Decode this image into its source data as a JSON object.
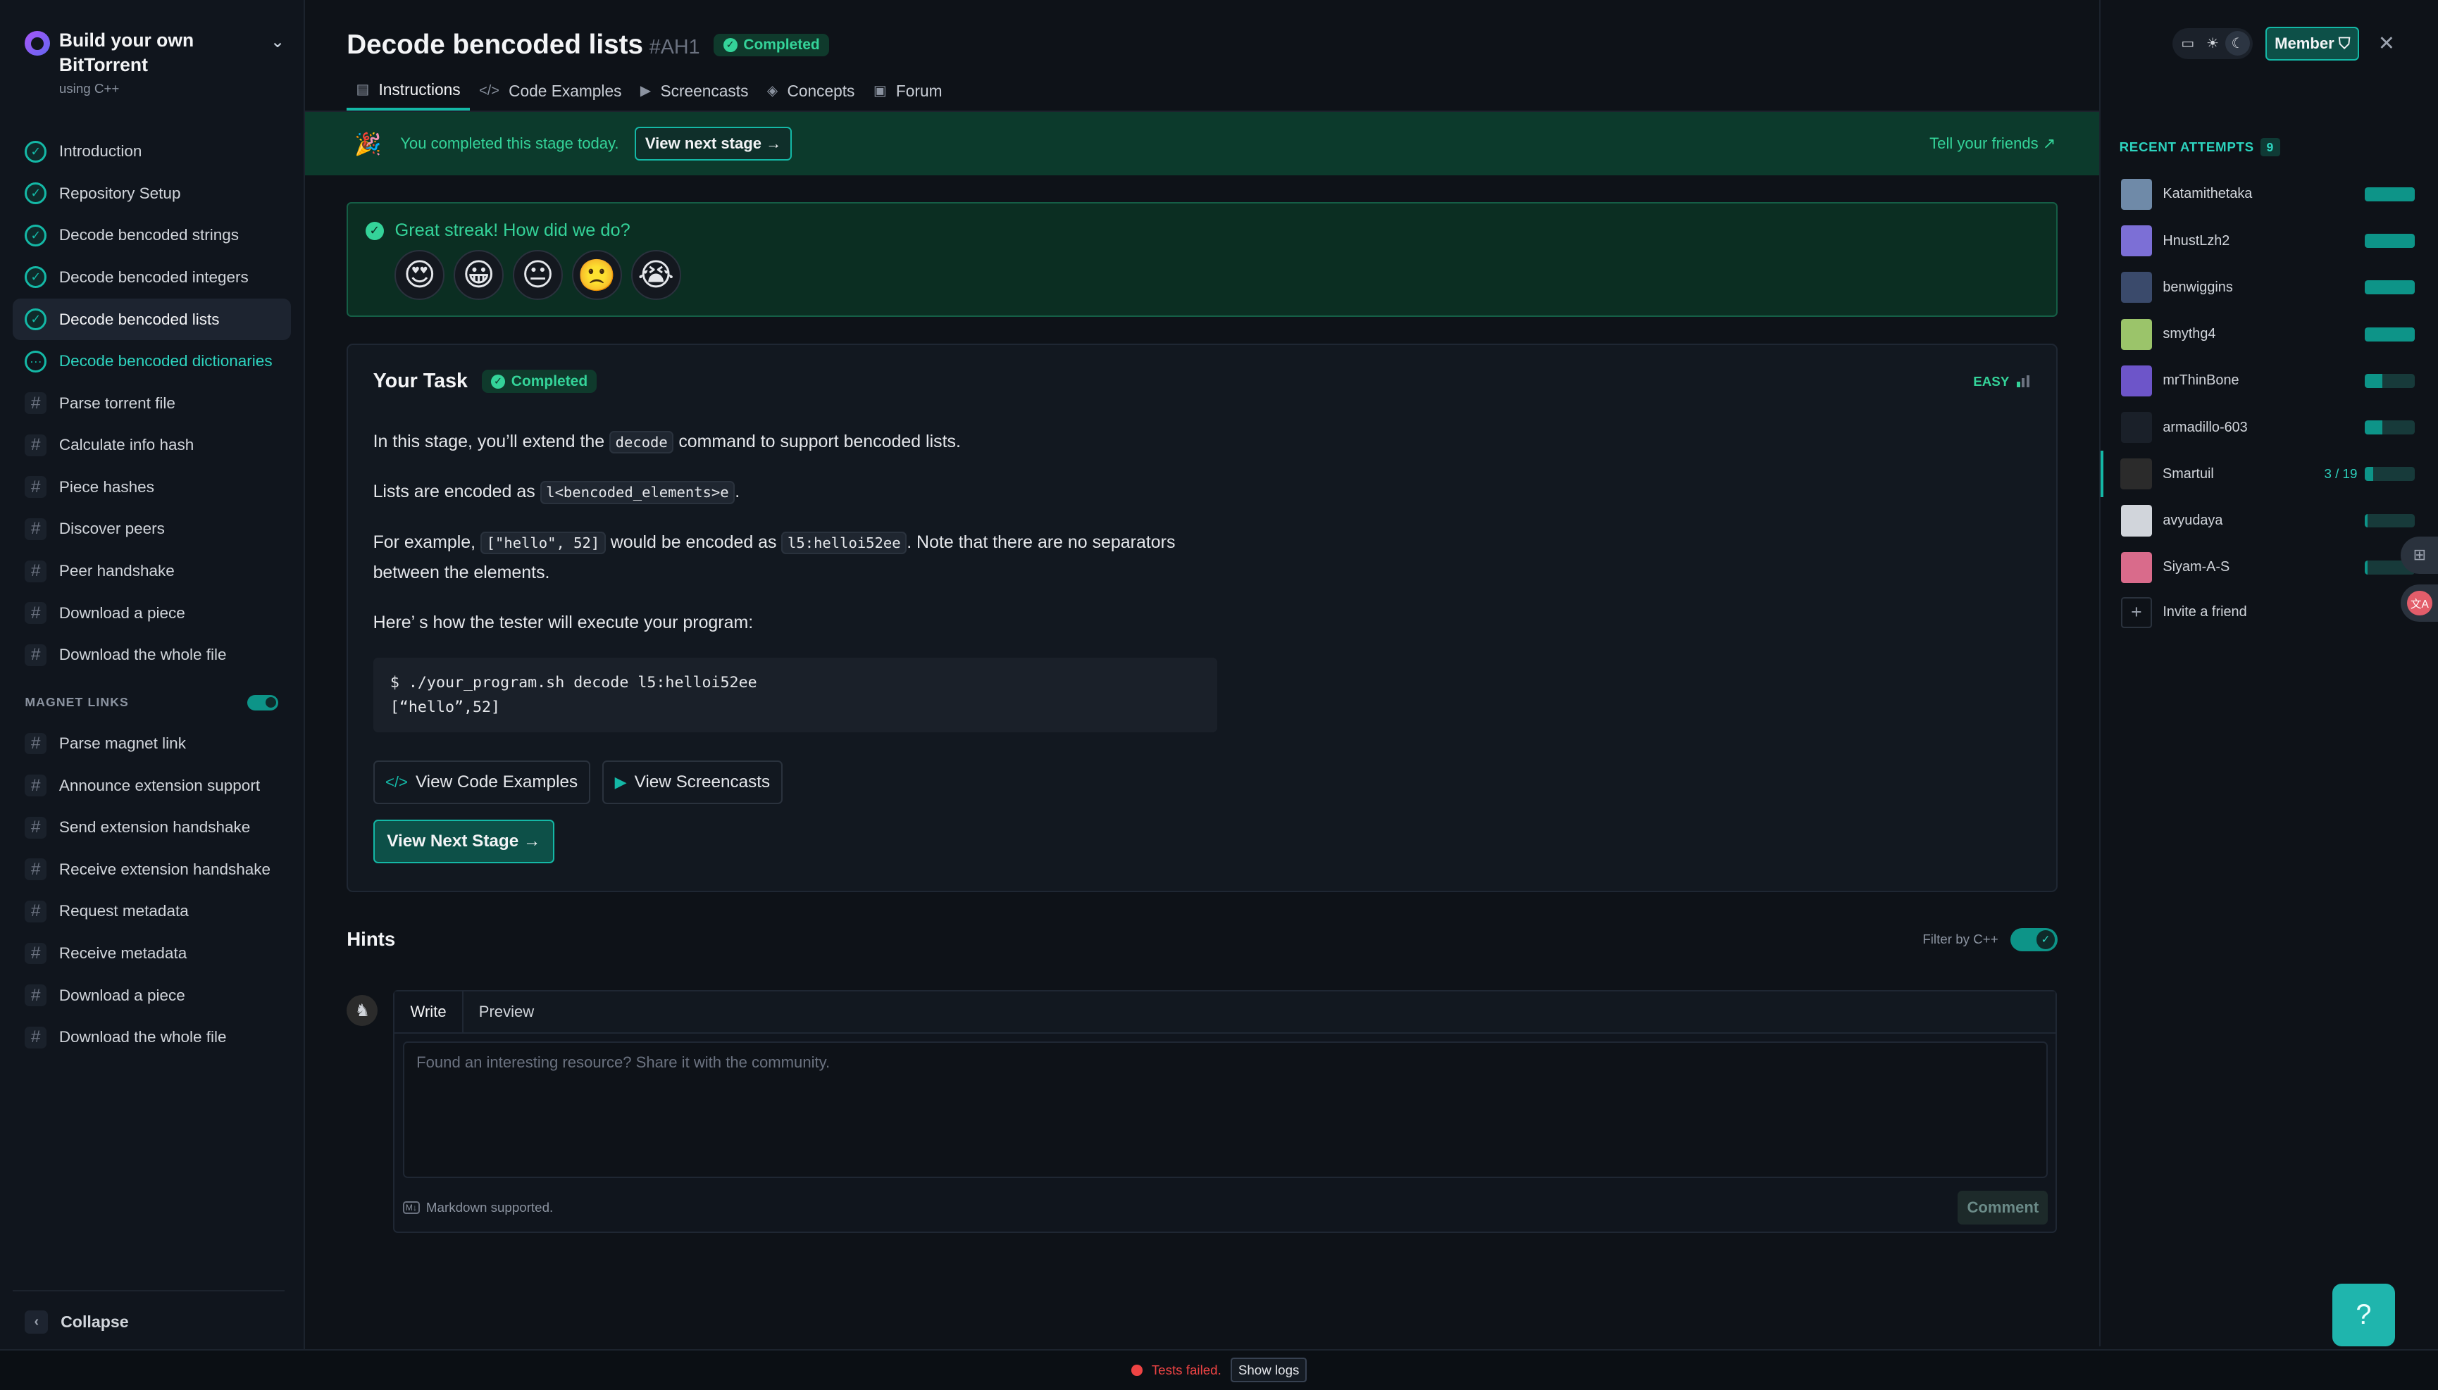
{
  "course": {
    "title": "Build your own BitTorrent",
    "language": "using C++"
  },
  "stages": [
    {
      "label": "Introduction",
      "status": "done"
    },
    {
      "label": "Repository Setup",
      "status": "done"
    },
    {
      "label": "Decode bencoded strings",
      "status": "done"
    },
    {
      "label": "Decode bencoded integers",
      "status": "done"
    },
    {
      "label": "Decode bencoded lists",
      "status": "done",
      "active": true
    },
    {
      "label": "Decode bencoded dictionaries",
      "status": "in-progress"
    },
    {
      "label": "Parse torrent file",
      "status": "locked"
    },
    {
      "label": "Calculate info hash",
      "status": "locked"
    },
    {
      "label": "Piece hashes",
      "status": "locked"
    },
    {
      "label": "Discover peers",
      "status": "locked"
    },
    {
      "label": "Peer handshake",
      "status": "locked"
    },
    {
      "label": "Download a piece",
      "status": "locked"
    },
    {
      "label": "Download the whole file",
      "status": "locked"
    }
  ],
  "magnet_section": {
    "label": "MAGNET LINKS",
    "enabled": true,
    "stages": [
      {
        "label": "Parse magnet link"
      },
      {
        "label": "Announce extension support"
      },
      {
        "label": "Send extension handshake"
      },
      {
        "label": "Receive extension handshake"
      },
      {
        "label": "Request metadata"
      },
      {
        "label": "Receive metadata"
      },
      {
        "label": "Download a piece"
      },
      {
        "label": "Download the whole file"
      }
    ]
  },
  "collapse_label": "Collapse",
  "header": {
    "title": "Decode bencoded lists",
    "code": "#AH1",
    "badge": "Completed",
    "tabs": [
      {
        "label": "Instructions",
        "icon": "document-icon",
        "active": true
      },
      {
        "label": "Code Examples",
        "icon": "code-icon"
      },
      {
        "label": "Screencasts",
        "icon": "play-icon"
      },
      {
        "label": "Concepts",
        "icon": "concepts-icon"
      },
      {
        "label": "Forum",
        "icon": "forum-icon"
      }
    ]
  },
  "banner": {
    "text": "You completed this stage today.",
    "next_label": "View next stage",
    "tell_label": "Tell your friends"
  },
  "feedback": {
    "title": "Great streak! How did we do?",
    "emojis": [
      "😍",
      "😀",
      "😐",
      "🙁",
      "😭"
    ]
  },
  "task": {
    "title": "Your Task",
    "badge": "Completed",
    "difficulty": "EASY",
    "p1_before": "In this stage, you’ll extend the",
    "p1_code": "decode",
    "p1_after": "command to support bencoded lists.",
    "p2_before": "Lists are encoded as",
    "p2_code": "l<bencoded_elements>e",
    "p2_after": ".",
    "p3_before": "For example,",
    "p3_code1": "[\"hello\", 52]",
    "p3_mid": "would be encoded as",
    "p3_code2": "l5:helloi52ee",
    "p3_after": ". Note that there are no separators between the elements.",
    "p4": "Here’ s how the tester will execute your program:",
    "code_line1": "$ ./your_program.sh decode l5:helloi52ee",
    "code_line2": "[“hello”,52]",
    "btn_examples": "View Code Examples",
    "btn_screencasts": "View Screencasts",
    "btn_next": "View Next Stage →"
  },
  "hints": {
    "title": "Hints",
    "filter_label": "Filter by C++",
    "filter_on": true,
    "tab_write": "Write",
    "tab_preview": "Preview",
    "placeholder": "Found an interesting resource? Share it with the community.",
    "markdown_note": "Markdown supported.",
    "comment_btn": "Comment"
  },
  "top_controls": {
    "member_label": "Member"
  },
  "recent_attempts": {
    "label": "RECENT ATTEMPTS",
    "count": "9",
    "items": [
      {
        "name": "Katamithetaka",
        "progress": 1.0,
        "color": "#6f8aa8"
      },
      {
        "name": "HnustLzh2",
        "progress": 1.0,
        "color": "#7c6fd6"
      },
      {
        "name": "benwiggins",
        "progress": 1.0,
        "color": "#3a4a6b"
      },
      {
        "name": "smythg4",
        "progress": 1.0,
        "color": "#9bc46a"
      },
      {
        "name": "mrThinBone",
        "progress": 0.35,
        "color": "#6d55c9"
      },
      {
        "name": "armadillo-603",
        "progress": 0.35,
        "color": "#1a2029"
      },
      {
        "name": "Smartuil",
        "progress": 0.16,
        "step": "3 / 19",
        "color": "#2b2b2b",
        "selected": true
      },
      {
        "name": "avyudaya",
        "progress": 0.05,
        "color": "#d1d5db"
      },
      {
        "name": "Siyam-A-S",
        "progress": 0.05,
        "color": "#d96b8b"
      }
    ],
    "invite_label": "Invite a friend"
  },
  "status": {
    "text": "Tests failed.",
    "logs_label": "Show logs"
  }
}
